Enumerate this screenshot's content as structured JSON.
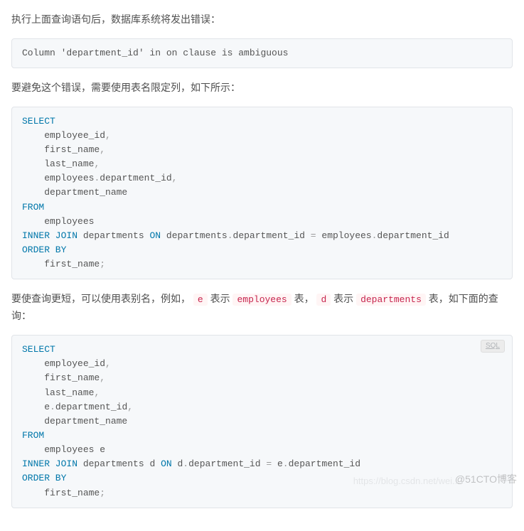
{
  "para1": "执行上面查询语句后，数据库系统将发出错误：",
  "error_code": "Column 'department_id' in on clause is ambiguous",
  "para2": "要避免这个错误，需要使用表名限定列，如下所示：",
  "sql1": {
    "kw_select": "SELECT",
    "col1": "employee_id",
    "col2": "first_name",
    "col3": "last_name",
    "tbl_emps": "employees",
    "dot": ".",
    "col_deptid": "department_id",
    "col5": "department_name",
    "kw_from": "FROM",
    "from_tbl": "employees",
    "kw_inner_join": "INNER JOIN",
    "join_tbl": "departments",
    "kw_on": "ON",
    "on_left_tbl": "departments",
    "eq": "=",
    "on_right_tbl": "employees",
    "kw_orderby": "ORDER BY",
    "orderby_col": "first_name",
    "comma": ",",
    "semi": ";"
  },
  "para3_pre": "要使查询更短，可以使用表别名，例如， ",
  "ic_e": "e",
  "para3_mid1": " 表示 ",
  "ic_employees": "employees",
  "para3_mid2": " 表， ",
  "ic_d": "d",
  "para3_mid3": " 表示 ",
  "ic_departments": "departments",
  "para3_end": " 表，如下面的查询：",
  "sql2": {
    "lang": "SQL",
    "kw_select": "SELECT",
    "col1": "employee_id",
    "col2": "first_name",
    "col3": "last_name",
    "alias_e": "e",
    "dot": ".",
    "col_deptid": "department_id",
    "col5": "department_name",
    "kw_from": "FROM",
    "from_tbl": "employees e",
    "kw_inner_join": "INNER JOIN",
    "join_tbl": "departments d",
    "kw_on": "ON",
    "on_left": "d",
    "eq": "=",
    "on_right": "e",
    "kw_orderby": "ORDER BY",
    "orderby_col": "first_name",
    "comma": ",",
    "semi": ";"
  },
  "watermark1": "@51CTO博客",
  "watermark2": "https://blog.csdn.net/wei..."
}
